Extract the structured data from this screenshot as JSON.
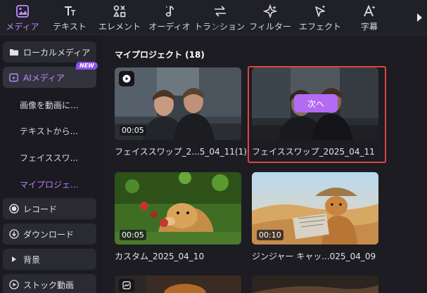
{
  "toolbar": {
    "tools": [
      {
        "label": "メディア",
        "icon": "media-icon",
        "active": true
      },
      {
        "label": "テキスト",
        "icon": "text-icon"
      },
      {
        "label": "エレメント",
        "icon": "elements-icon"
      },
      {
        "label": "オーディオ",
        "icon": "audio-icon"
      },
      {
        "label": "トランジション",
        "icon": "transition-icon"
      },
      {
        "label": "フィルター",
        "icon": "filter-icon"
      },
      {
        "label": "エフェクト",
        "icon": "effect-icon"
      },
      {
        "label": "字幕",
        "icon": "caption-icon"
      }
    ],
    "visible_labels": [
      "メディア",
      "テキスト",
      "エレメント",
      "オーディオ",
      "トラ",
      "ション",
      "フィルター",
      "エフェクト",
      "字幕"
    ]
  },
  "sidebar": {
    "local_media": "ローカルメディア",
    "ai_media": "AIメディア",
    "new_badge": "NEW",
    "sub_items": [
      "画像を動画に...",
      "テキストから...",
      "フェイススワ...",
      "マイプロジェ..."
    ],
    "record": "レコード",
    "download": "ダウンロード",
    "background": "背景",
    "stock_video": "ストック動画"
  },
  "main": {
    "section_title": "マイプロジェクト (18)",
    "next_button": "次へ",
    "cards": [
      {
        "caption": "フェイススワップ_2...5_04_11(1)",
        "duration": "00:05"
      },
      {
        "caption": "フェイススワップ_2025_04_11",
        "duration": ""
      },
      {
        "caption": "カスタム_2025_04_10",
        "duration": "00:05"
      },
      {
        "caption": "ジンジャー キャッ...025_04_09",
        "duration": "00:10"
      }
    ]
  },
  "colors": {
    "accent": "#b26cf3",
    "selection": "#e0453f",
    "panel": "#1c1c22"
  }
}
